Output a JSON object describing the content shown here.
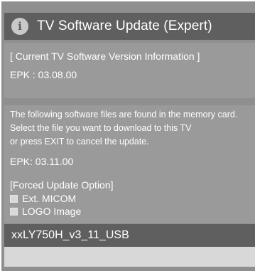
{
  "header": {
    "icon": "info-icon",
    "icon_glyph": "i",
    "title": "TV Software Update (Expert)"
  },
  "current_version": {
    "heading": "[ Current TV Software Version Information ]",
    "epk": "EPK : 03.08.00"
  },
  "found_files": {
    "line1": "The following software files are found in the memory card.",
    "line2": "Select the file you want to download to this TV",
    "line3": "or press EXIT to cancel the update.",
    "epk": "EPK: 03.11.00"
  },
  "forced_update": {
    "heading": "[Forced Update Option]",
    "options": [
      {
        "label": "Ext. MICOM",
        "checked": false
      },
      {
        "label": "LOGO Image",
        "checked": false
      }
    ]
  },
  "file_list": {
    "items": [
      "xxLY750H_v3_11_USB"
    ]
  }
}
